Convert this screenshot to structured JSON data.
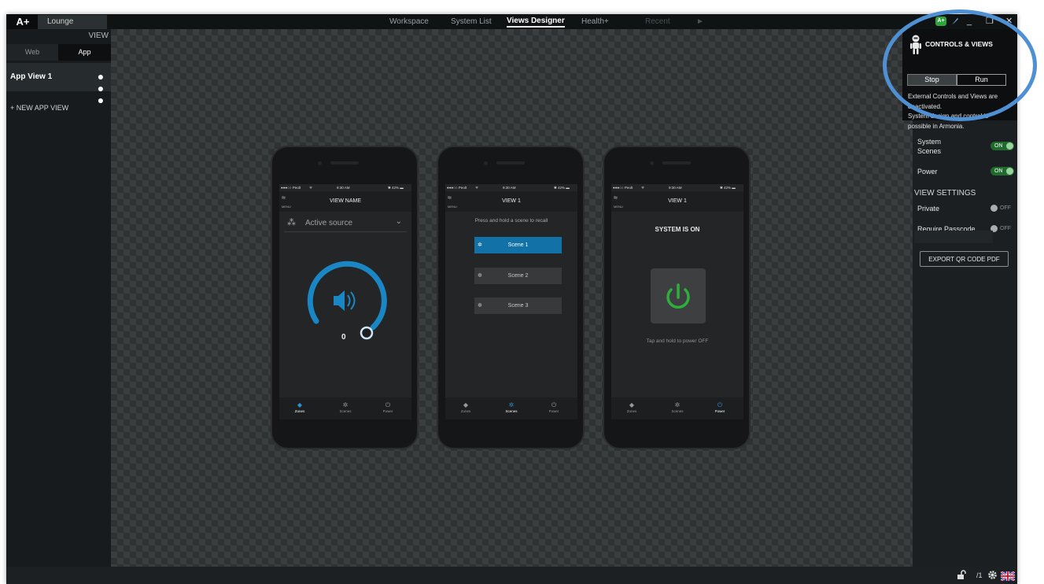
{
  "app": {
    "logo": "A+",
    "tab": "Lounge"
  },
  "nav": {
    "workspace": "Workspace",
    "system_list": "System List",
    "views_designer": "Views Designer",
    "health": "Health+",
    "recent": "Recent",
    "arrow": "►"
  },
  "window_controls": {
    "aplus_badge": "A+",
    "minimize": "_",
    "restore": "❐",
    "close": "✕"
  },
  "left_panel": {
    "view_label": "VIEW",
    "seg_web": "Web",
    "seg_app": "App",
    "app_view": "App View 1",
    "kebab": "⋮",
    "new_app_view": "+ NEW APP VIEW"
  },
  "popup": {
    "title": "CONTROLS & VIEWS",
    "stop": "Stop",
    "run": "Run",
    "line1": "External Controls and Views are deactivated.",
    "line2": "System design and control is possible in Armonia."
  },
  "right_panel": {
    "system_scenes_label": "System Scenes",
    "system_scenes_state": "ON",
    "power_label": "Power",
    "power_state": "ON",
    "view_settings": "VIEW SETTINGS",
    "private_label": "Private",
    "private_state": "OFF",
    "passcode_label": "Require Passcode",
    "passcode_state": "OFF",
    "export_button": "EXPORT QR CODE PDF"
  },
  "phones": {
    "status_carrier": "●●●○○ Peolt",
    "status_wifi": "ᯤ",
    "status_time": "9:30 AM",
    "status_battery": "✱ 42% ▬",
    "menu_label": "MENU",
    "phone1": {
      "title": "VIEW NAME",
      "source": "Active source",
      "volume": "0"
    },
    "phone2": {
      "title": "VIEW 1",
      "instruction": "Press and hold a scene to recall",
      "scenes": [
        "Scene 1",
        "Scene 2",
        "Scene 3"
      ]
    },
    "phone3": {
      "title": "VIEW 1",
      "status": "SYSTEM IS ON",
      "hint": "Tap and hold to power OFF"
    },
    "footer": {
      "zones": "Zones",
      "scenes": "Scenes",
      "power": "Power"
    }
  },
  "bottom_bar": {
    "page": "/1"
  },
  "colors": {
    "accent_blue": "#1272a8",
    "power_green": "#2fae3c",
    "highlight_circle": "#4f90d4"
  }
}
